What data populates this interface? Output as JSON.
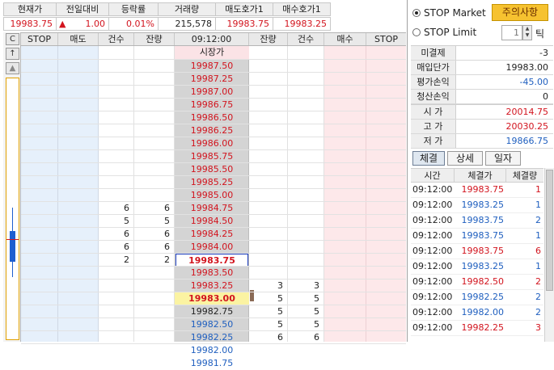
{
  "quote": {
    "headers": [
      "현재가",
      "전일대비",
      "등락률",
      "거래량",
      "매도호가1",
      "매수호가1"
    ],
    "current_price": "19983.75",
    "change_arrow": "▲",
    "change": "1.00",
    "change_rate": "0.01%",
    "volume": "215,578",
    "ask1": "19983.75",
    "bid1": "19983.25"
  },
  "orderbook": {
    "headers": [
      "STOP",
      "매도",
      "건수",
      "잔량",
      "09:12:00",
      "잔량",
      "건수",
      "매수",
      "STOP"
    ],
    "market_price_label": "시장가",
    "ctrl": {
      "c_label": "C",
      "up_label": "↑",
      "triangle_label": "▲"
    },
    "ask_prices": [
      "19987.50",
      "19987.25",
      "19987.00",
      "19986.75",
      "19986.50",
      "19986.25",
      "19986.00",
      "19985.75",
      "19985.50",
      "19985.25",
      "19985.00",
      "19984.75",
      "19984.50",
      "19984.25",
      "19984.00",
      "19983.75"
    ],
    "ask_counts": [
      "",
      "",
      "",
      "",
      "",
      "",
      "",
      "",
      "",
      "",
      "",
      "6",
      "5",
      "6",
      "6",
      "2"
    ],
    "ask_qty": [
      "",
      "",
      "",
      "",
      "",
      "",
      "",
      "",
      "",
      "",
      "",
      "6",
      "5",
      "6",
      "6",
      "2"
    ],
    "bid_prices": [
      "19983.50",
      "19983.25",
      "19983.00",
      "19982.75",
      "19982.50",
      "19982.25",
      "19982.00",
      "19981.75"
    ],
    "bid_qty": [
      "",
      "3",
      "5",
      "5",
      "5",
      "6",
      "",
      ""
    ],
    "bid_counts": [
      "",
      "3",
      "5",
      "5",
      "5",
      "6",
      "",
      ""
    ]
  },
  "right_panel": {
    "stop_market_label": "STOP Market",
    "stop_limit_label": "STOP Limit",
    "warning_button": "주의사항",
    "tick_value": "1",
    "tick_label": "틱",
    "rows": [
      {
        "k": "미결제",
        "v": "-3"
      },
      {
        "k": "매입단가",
        "v": "19983.00"
      },
      {
        "k": "평가손익",
        "v": "-45.00"
      },
      {
        "k": "청산손익",
        "v": "0"
      }
    ],
    "ohl": [
      {
        "k": "시 가",
        "v": "20014.75"
      },
      {
        "k": "고 가",
        "v": "20030.25"
      },
      {
        "k": "저 가",
        "v": "19866.75"
      }
    ],
    "tabs": [
      "체결",
      "상세",
      "일자"
    ],
    "trade_headers": [
      "시간",
      "체결가",
      "체결량"
    ],
    "trades": [
      {
        "time": "09:12:00",
        "price": "19983.75",
        "qty": "1",
        "color": "red"
      },
      {
        "time": "09:12:00",
        "price": "19983.25",
        "qty": "1",
        "color": "blue"
      },
      {
        "time": "09:12:00",
        "price": "19983.75",
        "qty": "2",
        "color": "blue"
      },
      {
        "time": "09:12:00",
        "price": "19983.75",
        "qty": "1",
        "color": "blue"
      },
      {
        "time": "09:12:00",
        "price": "19983.75",
        "qty": "6",
        "color": "red"
      },
      {
        "time": "09:12:00",
        "price": "19983.25",
        "qty": "1",
        "color": "blue"
      },
      {
        "time": "09:12:00",
        "price": "19982.50",
        "qty": "2",
        "color": "red"
      },
      {
        "time": "09:12:00",
        "price": "19982.25",
        "qty": "2",
        "color": "blue"
      },
      {
        "time": "09:12:00",
        "price": "19982.00",
        "qty": "2",
        "color": "blue"
      },
      {
        "time": "09:12:00",
        "price": "19982.25",
        "qty": "3",
        "color": "red"
      }
    ]
  },
  "colors": {
    "ask": "#d2141e",
    "bid": "#1f5fbf",
    "highlight": "#fbf3a2",
    "warning": "#f6c230"
  }
}
